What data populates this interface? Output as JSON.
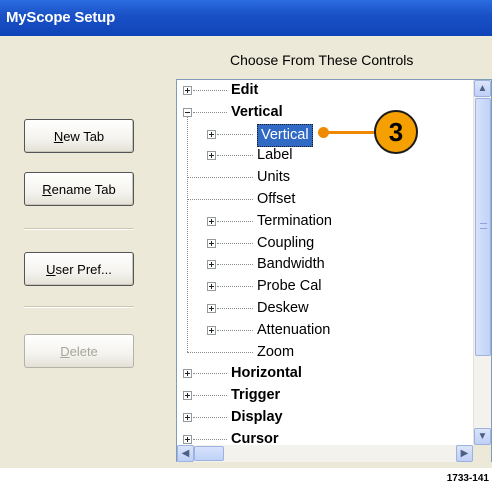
{
  "window": {
    "title": "MyScope Setup"
  },
  "panel": {
    "heading": "Choose From These Controls"
  },
  "buttons": {
    "new_tab": {
      "accel": "N",
      "rest": "ew Tab"
    },
    "rename_tab": {
      "accel": "R",
      "rest": "ename Tab"
    },
    "user_pref": {
      "accel": "U",
      "rest": "ser Pref..."
    },
    "delete": {
      "accel": "D",
      "rest": "elete",
      "enabled": false
    }
  },
  "tree": {
    "items": [
      {
        "label": "Edit",
        "level": 0,
        "expander": "plus",
        "bold": true
      },
      {
        "label": "Vertical",
        "level": 0,
        "expander": "minus",
        "bold": true
      },
      {
        "label": "Vertical",
        "level": 1,
        "expander": "plus",
        "selected": true
      },
      {
        "label": "Label",
        "level": 1,
        "expander": "plus"
      },
      {
        "label": "Units",
        "level": 1,
        "expander": "none"
      },
      {
        "label": "Offset",
        "level": 1,
        "expander": "none"
      },
      {
        "label": "Termination",
        "level": 1,
        "expander": "plus"
      },
      {
        "label": "Coupling",
        "level": 1,
        "expander": "plus"
      },
      {
        "label": "Bandwidth",
        "level": 1,
        "expander": "plus"
      },
      {
        "label": "Probe Cal",
        "level": 1,
        "expander": "plus"
      },
      {
        "label": "Deskew",
        "level": 1,
        "expander": "plus"
      },
      {
        "label": "Attenuation",
        "level": 1,
        "expander": "plus"
      },
      {
        "label": "Zoom",
        "level": 1,
        "expander": "none"
      },
      {
        "label": "Horizontal",
        "level": 0,
        "expander": "plus",
        "bold": true
      },
      {
        "label": "Trigger",
        "level": 0,
        "expander": "plus",
        "bold": true
      },
      {
        "label": "Display",
        "level": 0,
        "expander": "plus",
        "bold": true
      },
      {
        "label": "Cursor",
        "level": 0,
        "expander": "plus",
        "bold": true
      }
    ]
  },
  "callout": {
    "number": "3"
  },
  "figure_ref": "1733-141",
  "colors": {
    "titlebar": "#0f43b8",
    "selection": "#316ac5",
    "callout": "#f5a000"
  }
}
